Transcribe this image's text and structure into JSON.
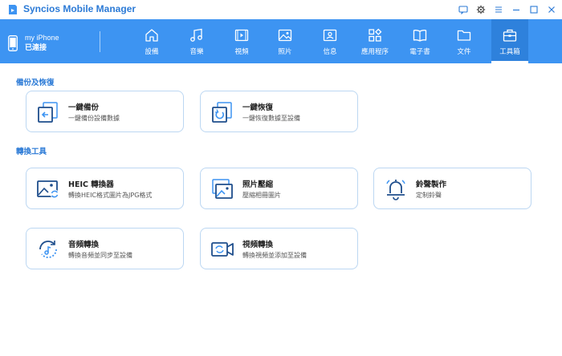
{
  "app": {
    "title": "Syncios Mobile Manager"
  },
  "window_controls": [
    {
      "name": "feedback-icon"
    },
    {
      "name": "settings-icon"
    },
    {
      "name": "menu-icon"
    },
    {
      "name": "minimize-icon"
    },
    {
      "name": "maximize-icon"
    },
    {
      "name": "close-icon"
    }
  ],
  "device": {
    "name": "my iPhone",
    "status": "已連接"
  },
  "nav": [
    {
      "label": "設備",
      "icon": "home-icon"
    },
    {
      "label": "音樂",
      "icon": "music-icon"
    },
    {
      "label": "視頻",
      "icon": "video-icon"
    },
    {
      "label": "照片",
      "icon": "photo-icon"
    },
    {
      "label": "信息",
      "icon": "contact-card-icon"
    },
    {
      "label": "應用程序",
      "icon": "apps-icon"
    },
    {
      "label": "電子書",
      "icon": "book-icon"
    },
    {
      "label": "文件",
      "icon": "folder-icon"
    },
    {
      "label": "工具箱",
      "icon": "toolbox-icon",
      "active": true
    }
  ],
  "sections": {
    "backup": {
      "title": "備份及恢復"
    },
    "convert": {
      "title": "轉換工具"
    }
  },
  "cards": {
    "backup": {
      "title": "一鍵備份",
      "desc": "一鍵備份設備數據",
      "icon": "backup-icon"
    },
    "restore": {
      "title": "一鍵恢復",
      "desc": "一鍵恢復數據至設備",
      "icon": "restore-icon"
    },
    "heic": {
      "title": "HEIC 轉換器",
      "desc": "轉換HEIC格式圖片為JPG格式",
      "icon": "heic-convert-icon"
    },
    "compress": {
      "title": "照片壓縮",
      "desc": "壓縮相冊圖片",
      "icon": "photo-compress-icon"
    },
    "ringtone": {
      "title": "鈴聲製作",
      "desc": "定制鈴聲",
      "icon": "bell-icon"
    },
    "audio": {
      "title": "音頻轉換",
      "desc": "轉換音頻並同步至設備",
      "icon": "audio-convert-icon"
    },
    "video": {
      "title": "視頻轉換",
      "desc": "轉換視頻並添加至設備",
      "icon": "video-convert-icon"
    }
  },
  "colors": {
    "accent": "#3d94f2",
    "accent_dark": "#2b7ad6",
    "card_border": "#bcd7f2",
    "icon_navy": "#1f4e8c"
  }
}
